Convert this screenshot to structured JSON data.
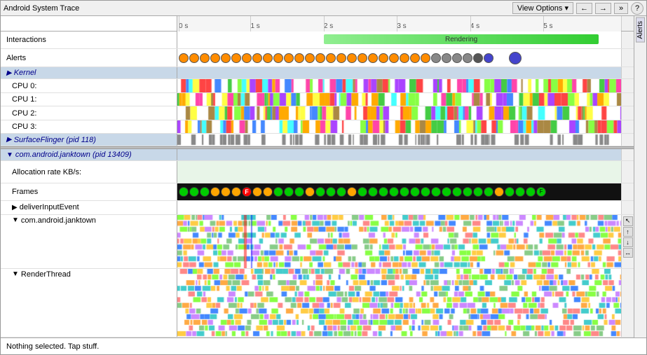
{
  "title": "Android System Trace",
  "header": {
    "title": "Android System Trace",
    "view_options_label": "View Options ▾",
    "nav_back": "←",
    "nav_fwd": "→",
    "nav_expand": "»",
    "help": "?"
  },
  "time_ruler": {
    "ticks": [
      "0 s",
      "1 s",
      "2 s",
      "3 s",
      "4 s",
      "5 s"
    ]
  },
  "sections": {
    "interactions": "Interactions",
    "alerts": "Alerts",
    "kernel": "Kernel",
    "cpu0": "CPU 0:",
    "cpu1": "CPU 1:",
    "cpu2": "CPU 2:",
    "cpu3": "CPU 3:",
    "surfaceflinger": "SurfaceFlinger (pid 118)",
    "janktown": "com.android.janktown (pid 13409)",
    "alloc_rate": "Allocation rate KB/s:",
    "frames": "Frames",
    "deliver": "deliverInputEvent",
    "com_janktown": "com.android.janktown",
    "render_thread": "RenderThread"
  },
  "side_tab": {
    "label": "Alerts"
  },
  "status": {
    "text": "Nothing selected. Tap stuff."
  },
  "colors": {
    "interactions_green": "#32cd32",
    "rendering_text": "Rendering",
    "section_header_bg": "#c8d8e8",
    "kernel_bg": "#c8d8e8",
    "jank_bg": "#c8d8e8",
    "render_bg": "#c8d8e8"
  }
}
